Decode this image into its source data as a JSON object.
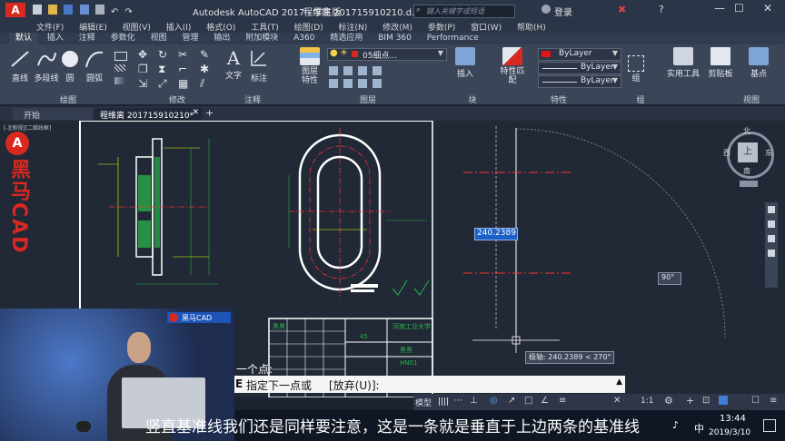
{
  "titlebar": {
    "app_title": "Autodesk AutoCAD 2017 - 学生版",
    "document_title": "程维离 201715910210.d...",
    "search_placeholder": "键入关键字或短语",
    "login_label": "登录"
  },
  "menu": {
    "items": [
      "文件(F)",
      "编辑(E)",
      "视图(V)",
      "插入(I)",
      "格式(O)",
      "工具(T)",
      "绘图(D)",
      "标注(N)",
      "修改(M)",
      "参数(P)",
      "窗口(W)",
      "帮助(H)"
    ]
  },
  "ribbon_tabs": [
    "默认",
    "插入",
    "注释",
    "参数化",
    "视图",
    "管理",
    "输出",
    "附加模块",
    "A360",
    "精选应用",
    "BIM 360",
    "Performance"
  ],
  "ribbon": {
    "draw_tools": [
      "直线",
      "多段线",
      "圆",
      "圆弧"
    ],
    "text_tools": [
      "文字",
      "标注"
    ],
    "layer_label": "图层特性",
    "layer_name": "05细点...",
    "insert_label": "插入",
    "match_label": "特性匹配",
    "bylayer_color": "ByLayer",
    "bylayer_linetype": "ByLayer",
    "bylayer_lineweight": "ByLayer",
    "group_label": "组",
    "utilities_label": "实用工具",
    "clipboard_label": "剪贴板",
    "base_label": "基点",
    "panels": [
      "绘图",
      "修改",
      "注释",
      "图层",
      "块",
      "特性",
      "组",
      "视图"
    ]
  },
  "doctabs": {
    "start_tab": "开始",
    "file_tab": "程维离 201715910210*"
  },
  "canvas": {
    "viewport_label": "[-][俯视][二维线框]",
    "viewcube_top": "上",
    "viewcube_north": "北",
    "viewcube_south": "南",
    "viewcube_west": "西",
    "viewcube_east": "东",
    "dimension_input": "240.2389",
    "angle_tooltip": "90°",
    "polar_tooltip": "极轴: 240.2389 < 270°",
    "table_text_1": "45",
    "table_text_2": "河南工业大学",
    "table_text_3": "黑黑",
    "table_text_4": "HN01",
    "table_text_5": "黑黑"
  },
  "command": {
    "history": "一个点:",
    "prompt": "指定下一点或",
    "option": "[放弃(U)]:"
  },
  "status": {
    "model_label": "模型",
    "scale_label": "1:1",
    "time": "13:44",
    "date": "2019/3/10",
    "ime": "中"
  },
  "webcam": {
    "logo_text": "黑马CAD"
  },
  "watermark": "黑马CAD",
  "subtitle": "竖直基准线我们还是同样要注意，这是一条就是垂直于上边两条的基准线",
  "colors": {
    "canvas_bg": "#212836",
    "ribbon_bg": "#3b4558",
    "dimension_yellow": "#e6ff00",
    "centerline_red": "#ff3333",
    "accent_red": "#d9281f"
  }
}
